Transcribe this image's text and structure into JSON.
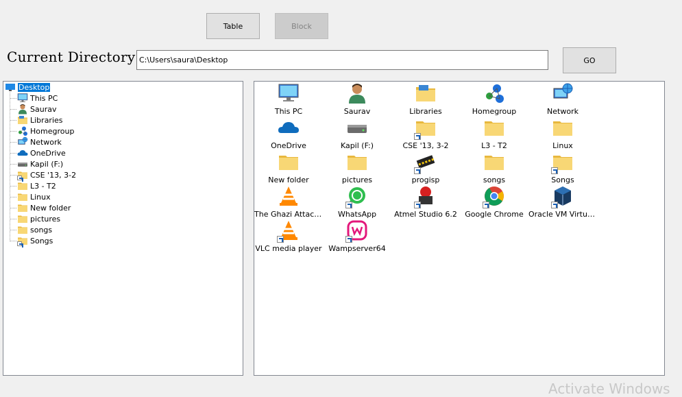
{
  "toolbar": {
    "table_label": "Table",
    "block_label": "Block",
    "go_label": "GO"
  },
  "directory": {
    "label": "Current Directory",
    "path": "C:\\Users\\saura\\Desktop"
  },
  "tree": {
    "items": [
      {
        "label": "Desktop",
        "icon": "desktop-icon",
        "selected": true
      },
      {
        "label": "This PC",
        "icon": "computer-icon"
      },
      {
        "label": "Saurav",
        "icon": "user-icon"
      },
      {
        "label": "Libraries",
        "icon": "libraries-icon"
      },
      {
        "label": "Homegroup",
        "icon": "homegroup-icon"
      },
      {
        "label": "Network",
        "icon": "network-icon"
      },
      {
        "label": "OneDrive",
        "icon": "onedrive-icon"
      },
      {
        "label": "Kapil (F:)",
        "icon": "drive-icon"
      },
      {
        "label": "CSE '13, 3-2",
        "icon": "folder-shortcut-icon"
      },
      {
        "label": "L3 - T2",
        "icon": "folder-icon"
      },
      {
        "label": "Linux",
        "icon": "folder-icon"
      },
      {
        "label": "New folder",
        "icon": "folder-icon"
      },
      {
        "label": "pictures",
        "icon": "folder-icon"
      },
      {
        "label": "songs",
        "icon": "folder-icon"
      },
      {
        "label": "Songs",
        "icon": "folder-shortcut-icon"
      }
    ]
  },
  "grid": {
    "items": [
      {
        "label": "This PC",
        "icon": "computer-icon"
      },
      {
        "label": "Saurav",
        "icon": "user-icon"
      },
      {
        "label": "Libraries",
        "icon": "libraries-icon"
      },
      {
        "label": "Homegroup",
        "icon": "homegroup-icon"
      },
      {
        "label": "Network",
        "icon": "network-icon"
      },
      {
        "label": "OneDrive",
        "icon": "onedrive-icon"
      },
      {
        "label": "Kapil (F:)",
        "icon": "drive-icon"
      },
      {
        "label": "CSE '13, 3-2",
        "icon": "folder-shortcut-icon"
      },
      {
        "label": "L3 - T2",
        "icon": "folder-icon"
      },
      {
        "label": "Linux",
        "icon": "folder-icon"
      },
      {
        "label": "New folder",
        "icon": "folder-icon"
      },
      {
        "label": "pictures",
        "icon": "folder-icon"
      },
      {
        "label": "progisp",
        "icon": "progisp-icon"
      },
      {
        "label": "songs",
        "icon": "folder-icon"
      },
      {
        "label": "Songs",
        "icon": "folder-shortcut-icon"
      },
      {
        "label": "The Ghazi Attack ...",
        "icon": "vlc-icon"
      },
      {
        "label": "WhatsApp",
        "icon": "whatsapp-icon"
      },
      {
        "label": "Atmel Studio 6.2",
        "icon": "atmel-icon"
      },
      {
        "label": "Google Chrome",
        "icon": "chrome-icon"
      },
      {
        "label": "Oracle VM Virtual...",
        "icon": "virtualbox-icon"
      },
      {
        "label": "VLC media player",
        "icon": "vlc-shortcut-icon"
      },
      {
        "label": "Wampserver64",
        "icon": "wamp-icon"
      }
    ]
  },
  "watermark": "Activate Windows"
}
